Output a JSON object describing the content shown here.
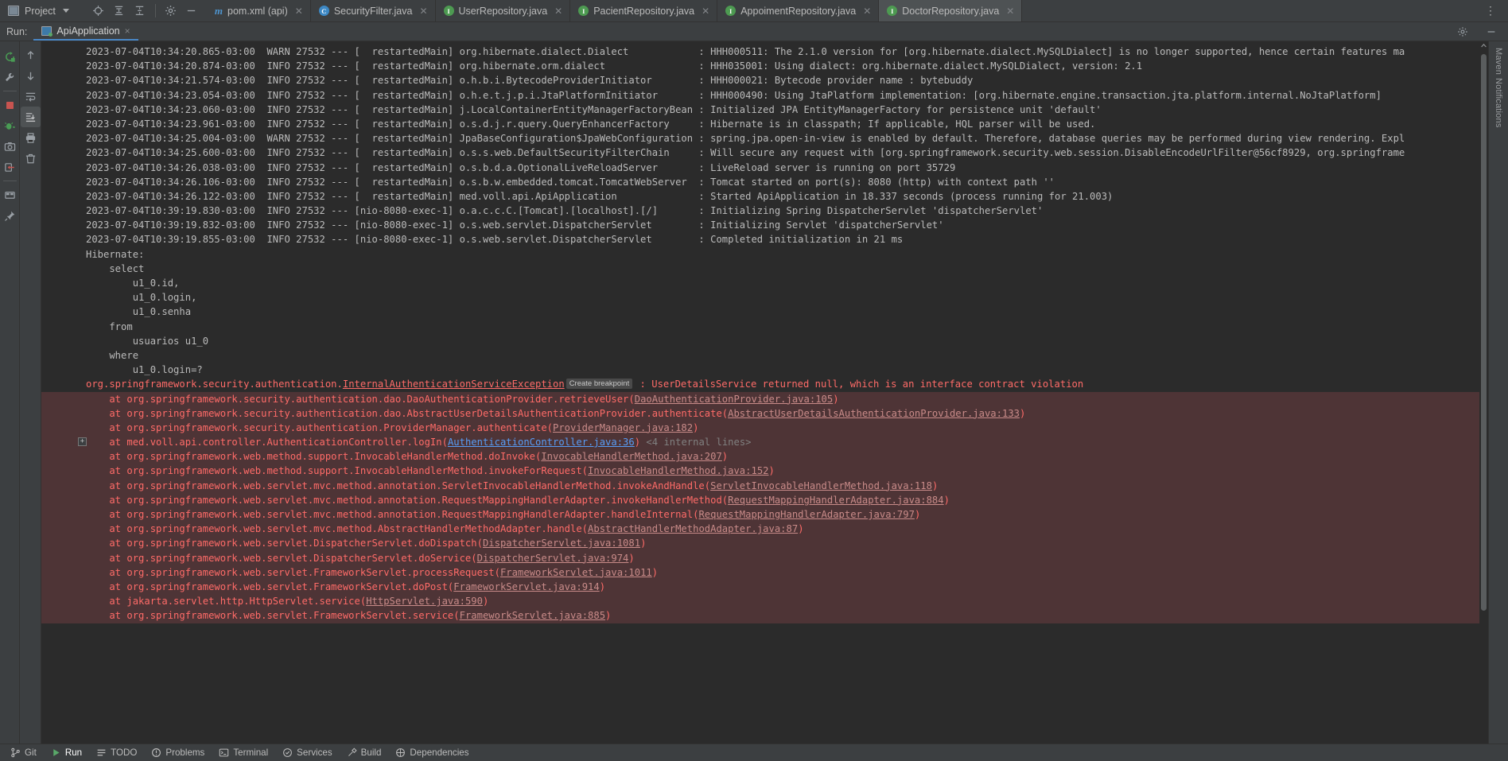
{
  "toolbar": {
    "project_label": "Project",
    "icons": [
      {
        "name": "locate-icon"
      },
      {
        "name": "collapse-all-icon"
      },
      {
        "name": "expand-all-icon"
      },
      {
        "name": "settings-gear-icon"
      },
      {
        "name": "hide-icon"
      }
    ],
    "overflow_label": "⋮"
  },
  "tabs": [
    {
      "label": "pom.xml (api)",
      "icon": "maven-icon",
      "icon_letter": "m",
      "kind": "m",
      "active": false
    },
    {
      "label": "SecurityFilter.java",
      "icon": "class-icon",
      "icon_letter": "C",
      "kind": "c",
      "active": false
    },
    {
      "label": "UserRepository.java",
      "icon": "interface-icon",
      "icon_letter": "I",
      "kind": "i",
      "active": false
    },
    {
      "label": "PacientRepository.java",
      "icon": "interface-icon",
      "icon_letter": "I",
      "kind": "i",
      "active": false
    },
    {
      "label": "AppoimentRepository.java",
      "icon": "interface-icon",
      "icon_letter": "I",
      "kind": "i",
      "active": false
    },
    {
      "label": "DoctorRepository.java",
      "icon": "interface-icon",
      "icon_letter": "I",
      "kind": "i",
      "active": true
    }
  ],
  "run_window": {
    "label": "Run:",
    "config_name": "ApiApplication",
    "close_label": "×",
    "settings_icon": "gear-icon",
    "minimize_icon": "minimize-icon"
  },
  "left_toolbar": [
    {
      "name": "rerun-icon"
    },
    {
      "name": "wrench-settings-icon"
    },
    {
      "name": "stop-icon"
    },
    {
      "name": "restart-debug-icon"
    },
    {
      "name": "camera-snapshot-icon"
    },
    {
      "name": "thread-dump-icon"
    },
    {
      "name": "layout-icon"
    },
    {
      "name": "pin-icon"
    }
  ],
  "console_toolbar": [
    {
      "name": "scroll-up-icon",
      "selected": false
    },
    {
      "name": "scroll-down-icon",
      "selected": false
    },
    {
      "name": "soft-wrap-icon",
      "selected": false
    },
    {
      "name": "scroll-to-end-icon",
      "selected": true
    },
    {
      "name": "print-icon",
      "selected": false
    },
    {
      "name": "clear-all-trash-icon",
      "selected": false
    }
  ],
  "right_sidebar": [
    {
      "label": "Maven",
      "name": "tool-window-maven"
    },
    {
      "label": "Notifications",
      "name": "tool-window-notifications"
    }
  ],
  "status_bar": [
    {
      "label": "Git",
      "icon": "git-branch-icon",
      "name": "status-git",
      "active": false
    },
    {
      "label": "Run",
      "icon": "run-triangle-icon",
      "name": "status-run",
      "active": true
    },
    {
      "label": "TODO",
      "icon": "todo-icon",
      "name": "status-todo",
      "active": false
    },
    {
      "label": "Problems",
      "icon": "problems-icon",
      "name": "status-problems",
      "active": false
    },
    {
      "label": "Terminal",
      "icon": "terminal-icon",
      "name": "status-terminal",
      "active": false
    },
    {
      "label": "Services",
      "icon": "services-icon",
      "name": "status-services",
      "active": false
    },
    {
      "label": "Build",
      "icon": "build-hammer-icon",
      "name": "status-build",
      "active": false
    },
    {
      "label": "Dependencies",
      "icon": "dependencies-icon",
      "name": "status-dependencies",
      "active": false
    }
  ],
  "console": {
    "lines": [
      {
        "type": "log",
        "text": "2023-07-04T10:34:20.865-03:00  WARN 27532 --- [  restartedMain] org.hibernate.dialect.Dialect            : HHH000511: The 2.1.0 version for [org.hibernate.dialect.MySQLDialect] is no longer supported, hence certain features ma"
      },
      {
        "type": "log",
        "text": "2023-07-04T10:34:20.874-03:00  INFO 27532 --- [  restartedMain] org.hibernate.orm.dialect                : HHH035001: Using dialect: org.hibernate.dialect.MySQLDialect, version: 2.1"
      },
      {
        "type": "log",
        "text": "2023-07-04T10:34:21.574-03:00  INFO 27532 --- [  restartedMain] o.h.b.i.BytecodeProviderInitiator        : HHH000021: Bytecode provider name : bytebuddy"
      },
      {
        "type": "log",
        "text": "2023-07-04T10:34:23.054-03:00  INFO 27532 --- [  restartedMain] o.h.e.t.j.p.i.JtaPlatformInitiator       : HHH000490: Using JtaPlatform implementation: [org.hibernate.engine.transaction.jta.platform.internal.NoJtaPlatform]"
      },
      {
        "type": "log",
        "text": "2023-07-04T10:34:23.060-03:00  INFO 27532 --- [  restartedMain] j.LocalContainerEntityManagerFactoryBean : Initialized JPA EntityManagerFactory for persistence unit 'default'"
      },
      {
        "type": "log",
        "text": "2023-07-04T10:34:23.961-03:00  INFO 27532 --- [  restartedMain] o.s.d.j.r.query.QueryEnhancerFactory     : Hibernate is in classpath; If applicable, HQL parser will be used."
      },
      {
        "type": "log",
        "text": "2023-07-04T10:34:25.004-03:00  WARN 27532 --- [  restartedMain] JpaBaseConfiguration$JpaWebConfiguration : spring.jpa.open-in-view is enabled by default. Therefore, database queries may be performed during view rendering. Expl"
      },
      {
        "type": "log",
        "text": "2023-07-04T10:34:25.600-03:00  INFO 27532 --- [  restartedMain] o.s.s.web.DefaultSecurityFilterChain     : Will secure any request with [org.springframework.security.web.session.DisableEncodeUrlFilter@56cf8929, org.springframe"
      },
      {
        "type": "log",
        "text": "2023-07-04T10:34:26.038-03:00  INFO 27532 --- [  restartedMain] o.s.b.d.a.OptionalLiveReloadServer       : LiveReload server is running on port 35729"
      },
      {
        "type": "log",
        "text": "2023-07-04T10:34:26.106-03:00  INFO 27532 --- [  restartedMain] o.s.b.w.embedded.tomcat.TomcatWebServer  : Tomcat started on port(s): 8080 (http) with context path ''"
      },
      {
        "type": "log",
        "text": "2023-07-04T10:34:26.122-03:00  INFO 27532 --- [  restartedMain] med.voll.api.ApiApplication              : Started ApiApplication in 18.337 seconds (process running for 21.003)"
      },
      {
        "type": "log",
        "text": "2023-07-04T10:39:19.830-03:00  INFO 27532 --- [nio-8080-exec-1] o.a.c.c.C.[Tomcat].[localhost].[/]       : Initializing Spring DispatcherServlet 'dispatcherServlet'"
      },
      {
        "type": "log",
        "text": "2023-07-04T10:39:19.832-03:00  INFO 27532 --- [nio-8080-exec-1] o.s.web.servlet.DispatcherServlet        : Initializing Servlet 'dispatcherServlet'"
      },
      {
        "type": "log",
        "text": "2023-07-04T10:39:19.855-03:00  INFO 27532 --- [nio-8080-exec-1] o.s.web.servlet.DispatcherServlet        : Completed initialization in 21 ms"
      },
      {
        "type": "sql",
        "text": "Hibernate: "
      },
      {
        "type": "sql",
        "text": "    select "
      },
      {
        "type": "sql",
        "text": "        u1_0.id, "
      },
      {
        "type": "sql",
        "text": "        u1_0.login, "
      },
      {
        "type": "sql",
        "text": "        u1_0.senha "
      },
      {
        "type": "sql",
        "text": "    from "
      },
      {
        "type": "sql",
        "text": "        usuarios u1_0 "
      },
      {
        "type": "sql",
        "text": "    where "
      },
      {
        "type": "sql",
        "text": "        u1_0.login=?"
      },
      {
        "type": "exception_head",
        "prefix": "org.springframework.security.authentication.",
        "link": "InternalAuthenticationServiceException",
        "badge": "Create breakpoint",
        "suffix": " : UserDetailsService returned null, which is an interface contract violation"
      },
      {
        "type": "trace",
        "prefix": "    at org.springframework.security.authentication.dao.DaoAuthenticationProvider.retrieveUser(",
        "link": "DaoAuthenticationProvider.java:105",
        "link_style": "grey",
        "suffix": ")"
      },
      {
        "type": "trace",
        "prefix": "    at org.springframework.security.authentication.dao.AbstractUserDetailsAuthenticationProvider.authenticate(",
        "link": "AbstractUserDetailsAuthenticationProvider.java:133",
        "link_style": "grey",
        "suffix": ")"
      },
      {
        "type": "trace",
        "prefix": "    at org.springframework.security.authentication.ProviderManager.authenticate(",
        "link": "ProviderManager.java:182",
        "link_style": "grey",
        "suffix": ")"
      },
      {
        "type": "trace",
        "fold": true,
        "prefix": "    at med.voll.api.controller.AuthenticationController.logIn(",
        "link": "AuthenticationController.java:36",
        "link_style": "blue",
        "suffix": ")",
        "foldtag": " <4 internal lines>"
      },
      {
        "type": "trace",
        "prefix": "    at org.springframework.web.method.support.InvocableHandlerMethod.doInvoke(",
        "link": "InvocableHandlerMethod.java:207",
        "link_style": "grey",
        "suffix": ")"
      },
      {
        "type": "trace",
        "prefix": "    at org.springframework.web.method.support.InvocableHandlerMethod.invokeForRequest(",
        "link": "InvocableHandlerMethod.java:152",
        "link_style": "grey",
        "suffix": ")"
      },
      {
        "type": "trace",
        "prefix": "    at org.springframework.web.servlet.mvc.method.annotation.ServletInvocableHandlerMethod.invokeAndHandle(",
        "link": "ServletInvocableHandlerMethod.java:118",
        "link_style": "grey",
        "suffix": ")"
      },
      {
        "type": "trace",
        "prefix": "    at org.springframework.web.servlet.mvc.method.annotation.RequestMappingHandlerAdapter.invokeHandlerMethod(",
        "link": "RequestMappingHandlerAdapter.java:884",
        "link_style": "grey",
        "suffix": ")"
      },
      {
        "type": "trace",
        "prefix": "    at org.springframework.web.servlet.mvc.method.annotation.RequestMappingHandlerAdapter.handleInternal(",
        "link": "RequestMappingHandlerAdapter.java:797",
        "link_style": "grey",
        "suffix": ")"
      },
      {
        "type": "trace",
        "prefix": "    at org.springframework.web.servlet.mvc.method.AbstractHandlerMethodAdapter.handle(",
        "link": "AbstractHandlerMethodAdapter.java:87",
        "link_style": "grey",
        "suffix": ")"
      },
      {
        "type": "trace",
        "prefix": "    at org.springframework.web.servlet.DispatcherServlet.doDispatch(",
        "link": "DispatcherServlet.java:1081",
        "link_style": "grey",
        "suffix": ")"
      },
      {
        "type": "trace",
        "prefix": "    at org.springframework.web.servlet.DispatcherServlet.doService(",
        "link": "DispatcherServlet.java:974",
        "link_style": "grey",
        "suffix": ")"
      },
      {
        "type": "trace",
        "prefix": "    at org.springframework.web.servlet.FrameworkServlet.processRequest(",
        "link": "FrameworkServlet.java:1011",
        "link_style": "grey",
        "suffix": ")"
      },
      {
        "type": "trace",
        "prefix": "    at org.springframework.web.servlet.FrameworkServlet.doPost(",
        "link": "FrameworkServlet.java:914",
        "link_style": "grey",
        "suffix": ")"
      },
      {
        "type": "trace",
        "prefix": "    at jakarta.servlet.http.HttpServlet.service(",
        "link": "HttpServlet.java:590",
        "link_style": "grey",
        "suffix": ")"
      },
      {
        "type": "trace",
        "prefix": "    at org.springframework.web.servlet.FrameworkServlet.service(",
        "link": "FrameworkServlet.java:885",
        "link_style": "grey",
        "suffix": ")"
      }
    ]
  },
  "colors": {
    "console_bg": "#2b2b2b",
    "chrome_bg": "#3c3f41",
    "error_fg": "#ff6b68",
    "error_bg": "#4e3436",
    "link_blue": "#589df6",
    "accent_tab": "#4a88c7",
    "text_fg": "#bbbbbb"
  }
}
